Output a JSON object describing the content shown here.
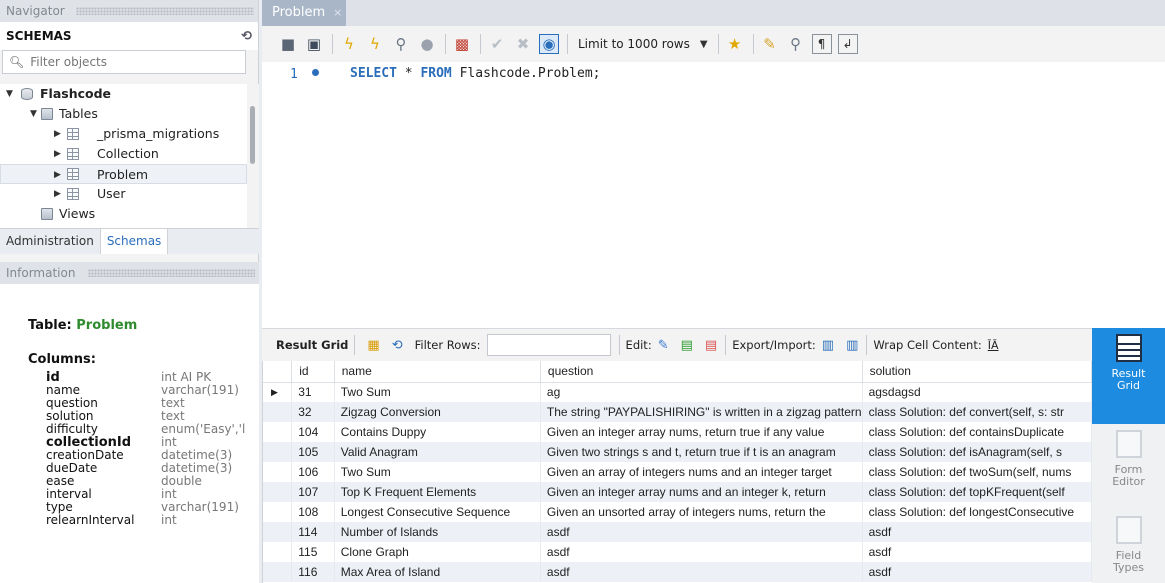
{
  "navigator": {
    "header": "Navigator",
    "schemas_label": "SCHEMAS",
    "filter_placeholder": "Filter objects",
    "tree": {
      "schema": "Flashcode",
      "tables_label": "Tables",
      "tables": [
        "_prisma_migrations",
        "Collection",
        "Problem",
        "User"
      ],
      "views_label": "Views"
    },
    "tabs": [
      "Administration",
      "Schemas"
    ]
  },
  "information": {
    "header": "Information",
    "table_label": "Table:",
    "table_name": "Problem",
    "columns_label": "Columns:",
    "columns": [
      {
        "name": "id",
        "type": "int AI PK"
      },
      {
        "name": "name",
        "type": "varchar(191)"
      },
      {
        "name": "question",
        "type": "text"
      },
      {
        "name": "solution",
        "type": "text"
      },
      {
        "name": "difficulty",
        "type": "enum('Easy','l"
      },
      {
        "name": "collectionId",
        "type": "int"
      },
      {
        "name": "creationDate",
        "type": "datetime(3)"
      },
      {
        "name": "dueDate",
        "type": "datetime(3)"
      },
      {
        "name": "ease",
        "type": "double"
      },
      {
        "name": "interval",
        "type": "int"
      },
      {
        "name": "type",
        "type": "varchar(191)"
      },
      {
        "name": "relearnInterval",
        "type": "int"
      }
    ]
  },
  "query_tab": {
    "title": "Problem",
    "close": "×"
  },
  "toolbar": {
    "limit_label": "Limit to 1000 rows"
  },
  "editor": {
    "line_number": "1",
    "keyword_select": "SELECT",
    "star": " * ",
    "keyword_from": "FROM",
    "rest": " Flashcode.Problem;"
  },
  "result_toolbar": {
    "result_grid": "Result Grid",
    "filter_rows": "Filter Rows:",
    "edit": "Edit:",
    "export_import": "Export/Import:",
    "wrap": "Wrap Cell Content:"
  },
  "grid": {
    "columns": [
      "id",
      "name",
      "question",
      "solution"
    ],
    "rows": [
      {
        "id": "31",
        "name": "Two Sum",
        "question": "ag",
        "solution": "agsdagsd"
      },
      {
        "id": "32",
        "name": "Zigzag Conversion",
        "question": "The string \"PAYPALISHIRING\" is written in a zigzag pattern",
        "solution": "class Solution:   def convert(self, s: str"
      },
      {
        "id": "104",
        "name": "Contains Duppy",
        "question": "Given an integer array nums, return true if any value",
        "solution": "class Solution:   def containsDuplicate"
      },
      {
        "id": "105",
        "name": "Valid Anagram",
        "question": "Given two strings s and t, return true if t is an anagram",
        "solution": "class Solution:   def isAnagram(self, s"
      },
      {
        "id": "106",
        "name": "Two Sum",
        "question": "Given an array of integers nums and an integer target",
        "solution": "class Solution:   def twoSum(self, nums"
      },
      {
        "id": "107",
        "name": "Top K Frequent Elements",
        "question": "Given an integer array nums and an integer k, return",
        "solution": "class Solution:   def topKFrequent(self"
      },
      {
        "id": "108",
        "name": "Longest Consecutive Sequence",
        "question": "Given an unsorted array of integers nums, return the",
        "solution": "class Solution:   def longestConsecutive"
      },
      {
        "id": "114",
        "name": "Number of Islands",
        "question": "asdf",
        "solution": "asdf"
      },
      {
        "id": "115",
        "name": "Clone Graph",
        "question": "asdf",
        "solution": "asdf"
      },
      {
        "id": "116",
        "name": "Max Area of Island",
        "question": "asdf",
        "solution": "asdf"
      }
    ]
  },
  "side_buttons": [
    {
      "label": "Result Grid"
    },
    {
      "label": "Form Editor"
    },
    {
      "label": "Field Types"
    }
  ]
}
